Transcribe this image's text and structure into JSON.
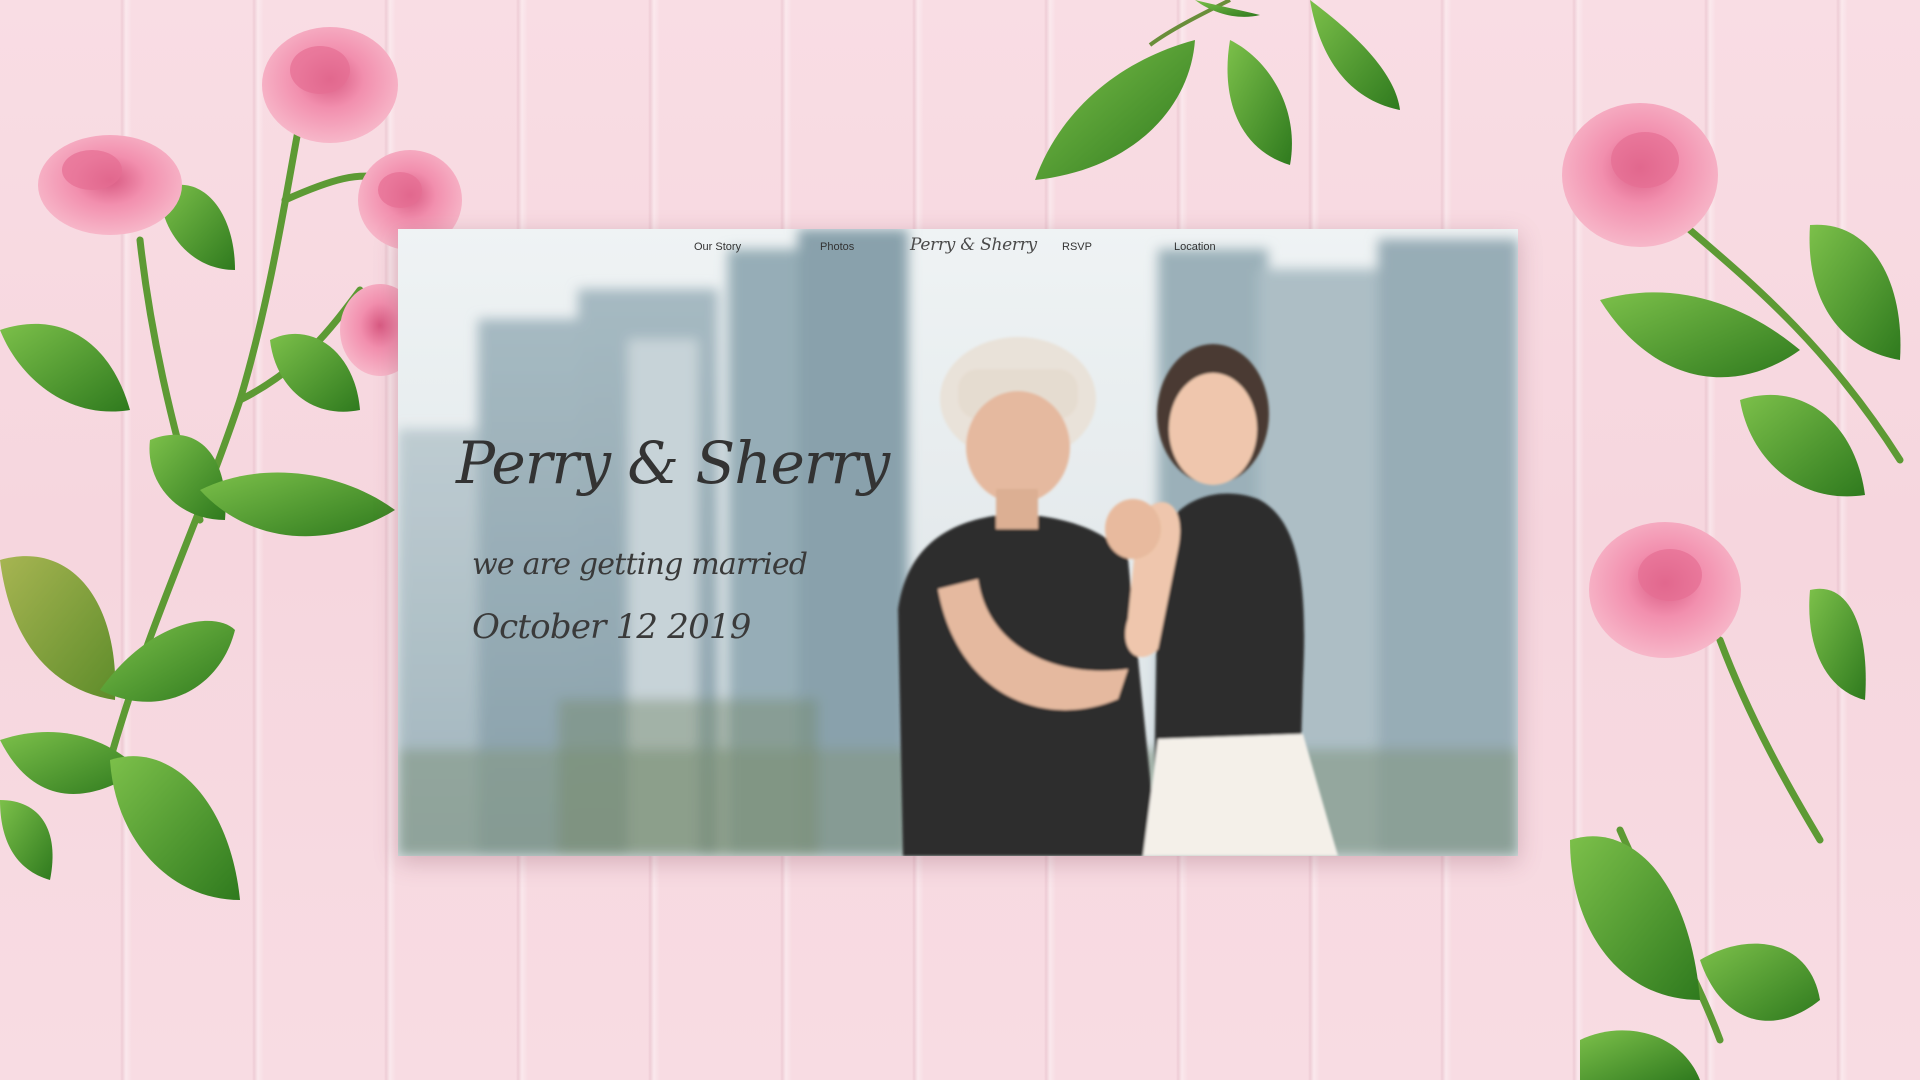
{
  "nav": {
    "items": [
      {
        "label": "Our Story"
      },
      {
        "label": "Photos"
      },
      {
        "label": "RSVP"
      },
      {
        "label": "Location"
      }
    ],
    "logo": "Perry & Sherry"
  },
  "hero": {
    "title": "Perry & Sherry",
    "subtitle": "we are getting married",
    "date": "October 12 2019"
  },
  "colors": {
    "background": "#f8dbe2",
    "rose": "#f19bb4",
    "leaf": "#4e9a2e",
    "text": "#333333"
  }
}
